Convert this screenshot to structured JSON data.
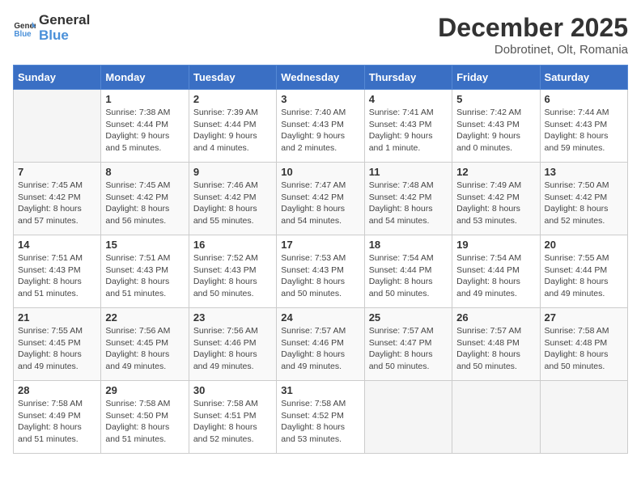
{
  "header": {
    "logo_general": "General",
    "logo_blue": "Blue",
    "month": "December 2025",
    "location": "Dobrotinet, Olt, Romania"
  },
  "days_of_week": [
    "Sunday",
    "Monday",
    "Tuesday",
    "Wednesday",
    "Thursday",
    "Friday",
    "Saturday"
  ],
  "weeks": [
    [
      {
        "day": "",
        "sunrise": "",
        "sunset": "",
        "daylight": ""
      },
      {
        "day": "1",
        "sunrise": "7:38 AM",
        "sunset": "4:44 PM",
        "daylight": "9 hours and 5 minutes."
      },
      {
        "day": "2",
        "sunrise": "7:39 AM",
        "sunset": "4:44 PM",
        "daylight": "9 hours and 4 minutes."
      },
      {
        "day": "3",
        "sunrise": "7:40 AM",
        "sunset": "4:43 PM",
        "daylight": "9 hours and 2 minutes."
      },
      {
        "day": "4",
        "sunrise": "7:41 AM",
        "sunset": "4:43 PM",
        "daylight": "9 hours and 1 minute."
      },
      {
        "day": "5",
        "sunrise": "7:42 AM",
        "sunset": "4:43 PM",
        "daylight": "9 hours and 0 minutes."
      },
      {
        "day": "6",
        "sunrise": "7:44 AM",
        "sunset": "4:43 PM",
        "daylight": "8 hours and 59 minutes."
      }
    ],
    [
      {
        "day": "7",
        "sunrise": "7:45 AM",
        "sunset": "4:42 PM",
        "daylight": "8 hours and 57 minutes."
      },
      {
        "day": "8",
        "sunrise": "7:45 AM",
        "sunset": "4:42 PM",
        "daylight": "8 hours and 56 minutes."
      },
      {
        "day": "9",
        "sunrise": "7:46 AM",
        "sunset": "4:42 PM",
        "daylight": "8 hours and 55 minutes."
      },
      {
        "day": "10",
        "sunrise": "7:47 AM",
        "sunset": "4:42 PM",
        "daylight": "8 hours and 54 minutes."
      },
      {
        "day": "11",
        "sunrise": "7:48 AM",
        "sunset": "4:42 PM",
        "daylight": "8 hours and 54 minutes."
      },
      {
        "day": "12",
        "sunrise": "7:49 AM",
        "sunset": "4:42 PM",
        "daylight": "8 hours and 53 minutes."
      },
      {
        "day": "13",
        "sunrise": "7:50 AM",
        "sunset": "4:42 PM",
        "daylight": "8 hours and 52 minutes."
      }
    ],
    [
      {
        "day": "14",
        "sunrise": "7:51 AM",
        "sunset": "4:43 PM",
        "daylight": "8 hours and 51 minutes."
      },
      {
        "day": "15",
        "sunrise": "7:51 AM",
        "sunset": "4:43 PM",
        "daylight": "8 hours and 51 minutes."
      },
      {
        "day": "16",
        "sunrise": "7:52 AM",
        "sunset": "4:43 PM",
        "daylight": "8 hours and 50 minutes."
      },
      {
        "day": "17",
        "sunrise": "7:53 AM",
        "sunset": "4:43 PM",
        "daylight": "8 hours and 50 minutes."
      },
      {
        "day": "18",
        "sunrise": "7:54 AM",
        "sunset": "4:44 PM",
        "daylight": "8 hours and 50 minutes."
      },
      {
        "day": "19",
        "sunrise": "7:54 AM",
        "sunset": "4:44 PM",
        "daylight": "8 hours and 49 minutes."
      },
      {
        "day": "20",
        "sunrise": "7:55 AM",
        "sunset": "4:44 PM",
        "daylight": "8 hours and 49 minutes."
      }
    ],
    [
      {
        "day": "21",
        "sunrise": "7:55 AM",
        "sunset": "4:45 PM",
        "daylight": "8 hours and 49 minutes."
      },
      {
        "day": "22",
        "sunrise": "7:56 AM",
        "sunset": "4:45 PM",
        "daylight": "8 hours and 49 minutes."
      },
      {
        "day": "23",
        "sunrise": "7:56 AM",
        "sunset": "4:46 PM",
        "daylight": "8 hours and 49 minutes."
      },
      {
        "day": "24",
        "sunrise": "7:57 AM",
        "sunset": "4:46 PM",
        "daylight": "8 hours and 49 minutes."
      },
      {
        "day": "25",
        "sunrise": "7:57 AM",
        "sunset": "4:47 PM",
        "daylight": "8 hours and 50 minutes."
      },
      {
        "day": "26",
        "sunrise": "7:57 AM",
        "sunset": "4:48 PM",
        "daylight": "8 hours and 50 minutes."
      },
      {
        "day": "27",
        "sunrise": "7:58 AM",
        "sunset": "4:48 PM",
        "daylight": "8 hours and 50 minutes."
      }
    ],
    [
      {
        "day": "28",
        "sunrise": "7:58 AM",
        "sunset": "4:49 PM",
        "daylight": "8 hours and 51 minutes."
      },
      {
        "day": "29",
        "sunrise": "7:58 AM",
        "sunset": "4:50 PM",
        "daylight": "8 hours and 51 minutes."
      },
      {
        "day": "30",
        "sunrise": "7:58 AM",
        "sunset": "4:51 PM",
        "daylight": "8 hours and 52 minutes."
      },
      {
        "day": "31",
        "sunrise": "7:58 AM",
        "sunset": "4:52 PM",
        "daylight": "8 hours and 53 minutes."
      },
      {
        "day": "",
        "sunrise": "",
        "sunset": "",
        "daylight": ""
      },
      {
        "day": "",
        "sunrise": "",
        "sunset": "",
        "daylight": ""
      },
      {
        "day": "",
        "sunrise": "",
        "sunset": "",
        "daylight": ""
      }
    ]
  ]
}
